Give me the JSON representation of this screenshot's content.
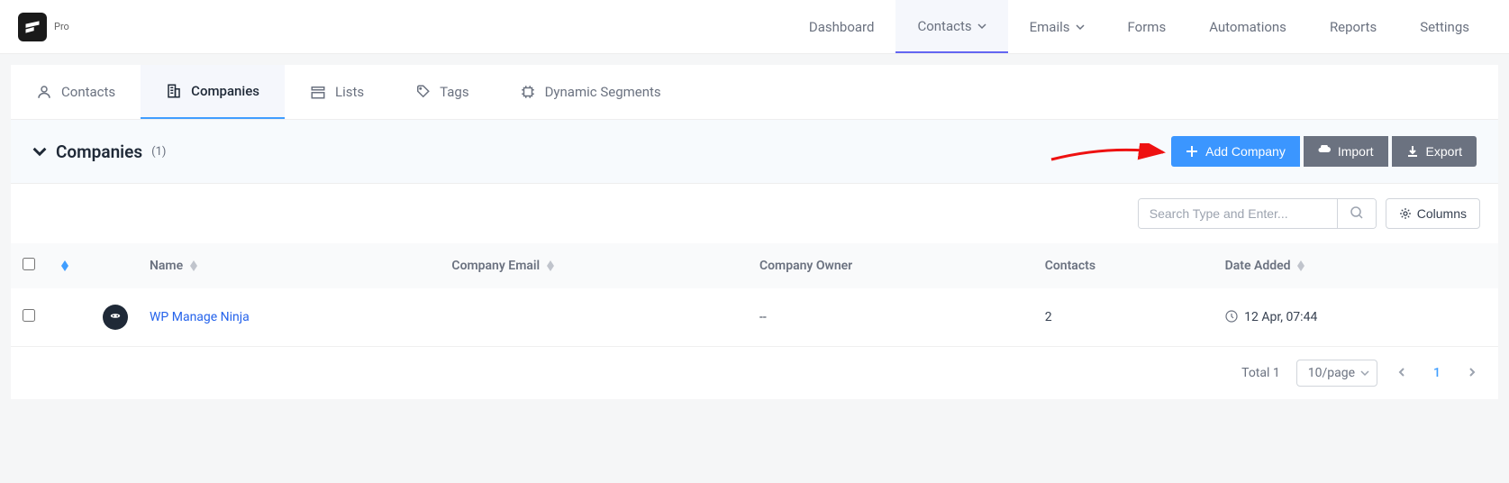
{
  "header": {
    "pro_label": "Pro",
    "nav": {
      "dashboard": "Dashboard",
      "contacts": "Contacts",
      "emails": "Emails",
      "forms": "Forms",
      "automations": "Automations",
      "reports": "Reports",
      "settings": "Settings"
    }
  },
  "subtabs": {
    "contacts": "Contacts",
    "companies": "Companies",
    "lists": "Lists",
    "tags": "Tags",
    "dynamic_segments": "Dynamic Segments"
  },
  "page": {
    "title": "Companies",
    "count": "(1)",
    "actions": {
      "add": "Add Company",
      "import": "Import",
      "export": "Export"
    }
  },
  "toolbar": {
    "search_placeholder": "Search Type and Enter...",
    "columns_label": "Columns"
  },
  "table": {
    "headers": {
      "name": "Name",
      "email": "Company Email",
      "owner": "Company Owner",
      "contacts": "Contacts",
      "date_added": "Date Added"
    },
    "rows": [
      {
        "name": "WP Manage Ninja",
        "email": "",
        "owner": "--",
        "contacts": "2",
        "date_added": "12 Apr, 07:44"
      }
    ]
  },
  "pagination": {
    "total_label": "Total 1",
    "per_page": "10/page",
    "current": "1"
  }
}
